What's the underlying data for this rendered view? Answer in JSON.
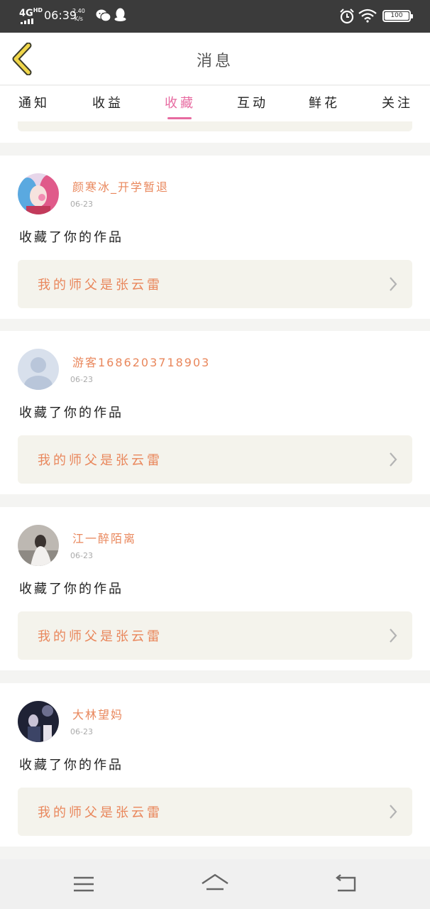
{
  "status_bar": {
    "network": "4G",
    "network_sup": "HD",
    "time": "06:39",
    "speed_value": "2.40",
    "speed_unit": "K/s",
    "battery": "100"
  },
  "header": {
    "title": "消息"
  },
  "tabs": [
    {
      "label": "通知",
      "active": false
    },
    {
      "label": "收益",
      "active": false
    },
    {
      "label": "收藏",
      "active": true
    },
    {
      "label": "互动",
      "active": false
    },
    {
      "label": "鲜花",
      "active": false
    },
    {
      "label": "关注",
      "active": false
    }
  ],
  "messages": [
    {
      "username": "颜寒冰_开学暂退",
      "date": "06-23",
      "action": "收藏了你的作品",
      "work_title": "我的师父是张云雷",
      "avatar": "avatar-cosplay"
    },
    {
      "username": "游客1686203718903",
      "date": "06-23",
      "action": "收藏了你的作品",
      "work_title": "我的师父是张云雷",
      "avatar": "avatar-default"
    },
    {
      "username": "江一醉陌离",
      "date": "06-23",
      "action": "收藏了你的作品",
      "work_title": "我的师父是张云雷",
      "avatar": "avatar-bride"
    },
    {
      "username": "大林望妈",
      "date": "06-23",
      "action": "收藏了你的作品",
      "work_title": "我的师父是张云雷",
      "avatar": "avatar-night"
    }
  ],
  "colors": {
    "accent": "#e76aa0",
    "name_color": "#e9875c",
    "card_box": "#f4f3ec"
  },
  "icons": {
    "back": "back-arrow-icon",
    "chevron": "chevron-right-icon",
    "nav_menu": "menu-icon",
    "nav_home": "home-icon",
    "nav_back": "back-icon"
  }
}
